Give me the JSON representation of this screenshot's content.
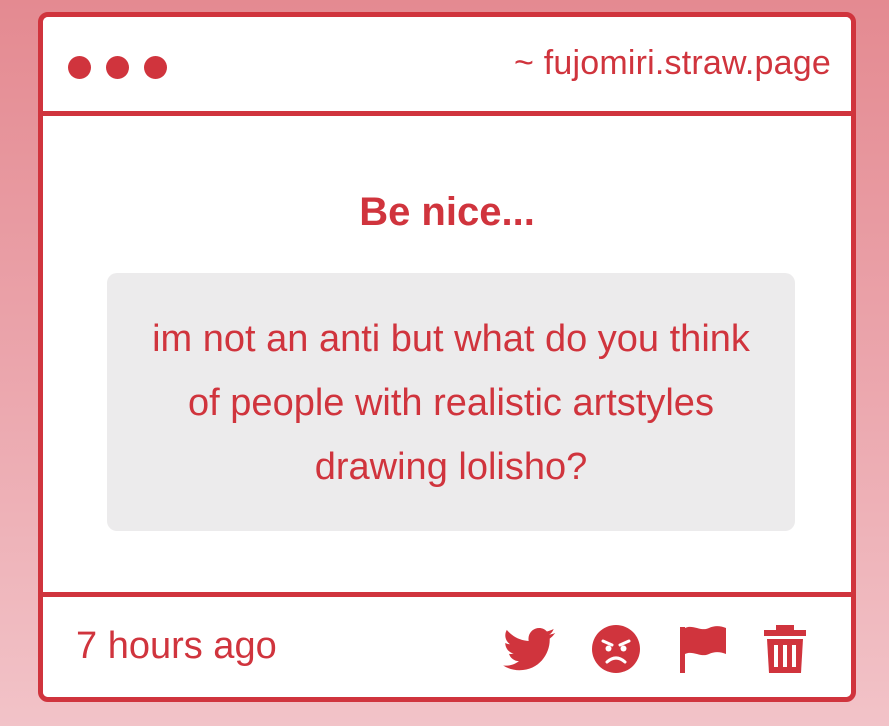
{
  "window": {
    "url": "~ fujomiri.straw.page"
  },
  "content": {
    "heading": "Be nice...",
    "message": "im not an anti but what do you think of people with realistic artstyles drawing lolisho?"
  },
  "footer": {
    "time": "7 hours ago",
    "actions": [
      {
        "icon": "twitter-icon"
      },
      {
        "icon": "angry-face-icon"
      },
      {
        "icon": "flag-icon"
      },
      {
        "icon": "trash-icon"
      }
    ]
  },
  "colors": {
    "accent": "#d0343d",
    "message_background": "#ecebec",
    "page_background_top": "#e48a91",
    "page_background_bottom": "#f2c3c8"
  }
}
